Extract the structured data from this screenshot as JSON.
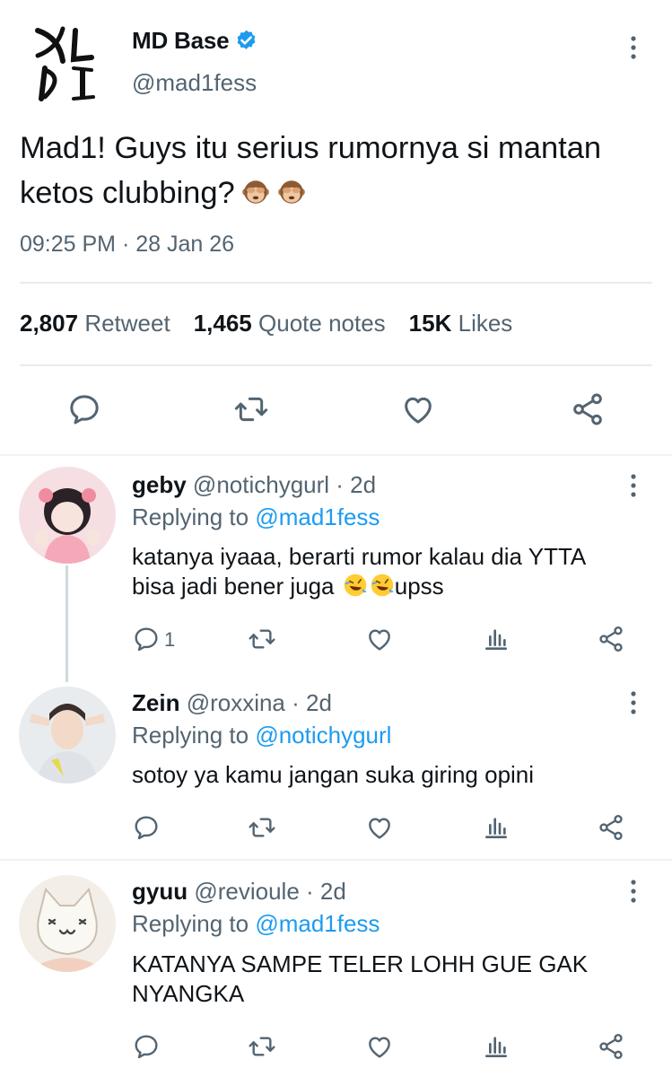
{
  "tweet": {
    "account_name": "MD Base",
    "handle": "@mad1fess",
    "text": "Mad1! Guys itu serius rumornya si mantan ketos clubbing?",
    "timestamp": "09:25 PM · 28 Jan 26",
    "stats": {
      "retweets": {
        "count": "2,807",
        "label": "Retweet"
      },
      "quotes": {
        "count": "1,465",
        "label": "Quote notes"
      },
      "likes": {
        "count": "15K",
        "label": "Likes"
      }
    },
    "emojis": [
      "see-no-evil-monkey",
      "see-no-evil-monkey"
    ]
  },
  "replies": [
    {
      "name": "geby",
      "handle_time": "@notichygurl · 2d",
      "replying_prefix": "Replying to",
      "replying_to": "@mad1fess",
      "text_line1": "katanya iyaaa, berarti rumor kalau dia YTTA",
      "text_line2a": "bisa jadi bener juga",
      "text_line2b": "upss",
      "reply_count": "1",
      "emojis": [
        "rolling-on-floor-laughing",
        "rolling-on-floor-laughing"
      ]
    },
    {
      "name": "Zein",
      "handle_time": "@roxxina · 2d",
      "replying_prefix": "Replying to",
      "replying_to": "@notichygurl",
      "text": "sotoy ya kamu jangan suka giring opini"
    },
    {
      "name": "gyuu",
      "handle_time": "@revioule · 2d",
      "replying_prefix": "Replying to",
      "replying_to": "@mad1fess",
      "text_line1": "KATANYA SAMPE TELER LOHH GUE GAK",
      "text_line2": "NYANGKA"
    }
  ],
  "colors": {
    "accent": "#1d9bf0",
    "secondary_text": "#536471",
    "divider": "#e6ecf0"
  }
}
